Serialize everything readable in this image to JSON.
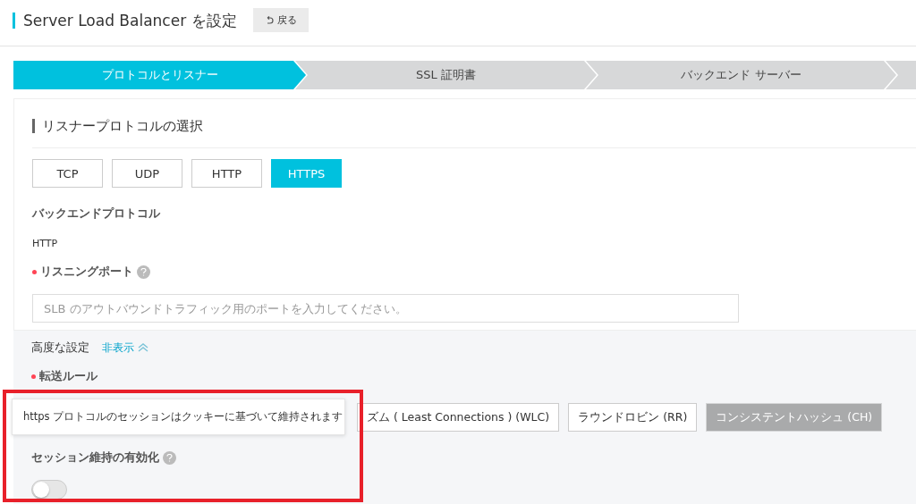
{
  "header": {
    "title": "Server Load Balancer を設定",
    "back_button": "戻る"
  },
  "steps": [
    {
      "label": "プロトコルとリスナー",
      "selected": true
    },
    {
      "label": "SSL 証明書",
      "selected": false
    },
    {
      "label": "バックエンド サーバー",
      "selected": false
    },
    {
      "selected": false
    }
  ],
  "section_title": "リスナープロトコルの選択",
  "protocols": [
    {
      "label": "TCP",
      "selected": false
    },
    {
      "label": "UDP",
      "selected": false
    },
    {
      "label": "HTTP",
      "selected": false
    },
    {
      "label": "HTTPS",
      "selected": true
    }
  ],
  "backend_protocol": {
    "label": "バックエンドプロトコル",
    "value": "HTTP"
  },
  "listening_port": {
    "label": "リスニングポート",
    "required": true,
    "placeholder": "SLB のアウトバウンドトラフィック用のポートを入力してください。"
  },
  "advanced": {
    "label": "高度な設定",
    "toggle_link": "非表示",
    "expanded": true
  },
  "forwarding_rule": {
    "label": "転送ルール",
    "required": true,
    "options": [
      {
        "label": "ズム ( Least Connections ) (WLC)",
        "disabled": false
      },
      {
        "label": "ラウンドロビン (RR)",
        "disabled": false
      },
      {
        "label": "コンシステントハッシュ (CH)",
        "disabled": true
      }
    ]
  },
  "tooltip": "https プロトコルのセッションはクッキーに基づいて維持されます",
  "session": {
    "label": "セッション維持の有効化",
    "on": false
  }
}
